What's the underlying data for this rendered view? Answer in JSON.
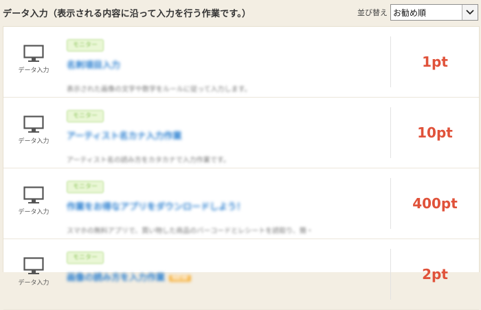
{
  "header": {
    "title": "データ入力（表示される内容に沿って入力を行う作業です。）",
    "sort_label": "並び替え",
    "sort_value": "お勧め順"
  },
  "items": [
    {
      "category": "データ入力",
      "badge": "モニター",
      "title": "名刺項目入力",
      "description": "表示された画像の文字や数字をルールに従って入力します。",
      "points": "1pt"
    },
    {
      "category": "データ入力",
      "badge": "モニター",
      "title": "アーティスト名カナ入力作業",
      "description": "アーティスト名の読み方をカタカナで入力作業です。",
      "points": "10pt"
    },
    {
      "category": "データ入力",
      "badge": "モニター",
      "title": "作業をお得なアプリをダウンロードしよう！",
      "description": "スマホの無料アプリで、買い物した商品のバーコードとレシートを読取り、簡・",
      "points": "400pt"
    },
    {
      "category": "データ入力",
      "badge": "モニター",
      "title": "画像の読み方を入力作業",
      "new": "NEW",
      "description": "",
      "points": "2pt"
    }
  ]
}
